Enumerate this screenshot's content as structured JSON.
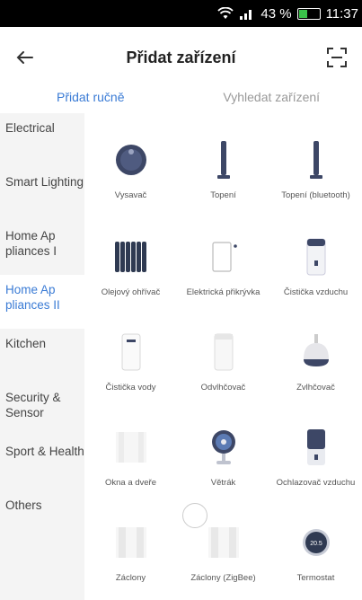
{
  "status_bar": {
    "battery": "43 %",
    "time": "11:37"
  },
  "header": {
    "title": "Přidat zařízení"
  },
  "tabs": [
    {
      "label": "Přidat ručně",
      "active": true
    },
    {
      "label": "Vyhledat zařízení",
      "active": false
    }
  ],
  "sidebar": {
    "items": [
      {
        "label": "Electrical"
      },
      {
        "label": "Smart Lighting"
      },
      {
        "label": "Home Ap pliances I"
      },
      {
        "label": "Home Ap pliances II",
        "active": true
      },
      {
        "label": "Kitchen"
      },
      {
        "label": "Security & Sensor"
      },
      {
        "label": "Sport & Health"
      },
      {
        "label": "Others"
      }
    ]
  },
  "devices": [
    {
      "label": "Vysavač",
      "icon": "robot-vacuum-icon"
    },
    {
      "label": "Topení",
      "icon": "tower-heater-icon"
    },
    {
      "label": "Topení (bluetooth)",
      "icon": "tower-heater-bluetooth-icon"
    },
    {
      "label": "Olejový ohřívač",
      "icon": "oil-heater-icon"
    },
    {
      "label": "Elektrická přikrývka",
      "icon": "electric-blanket-icon"
    },
    {
      "label": "Čistička vzduchu",
      "icon": "air-purifier-icon"
    },
    {
      "label": "Čistička vody",
      "icon": "water-purifier-icon"
    },
    {
      "label": "Odvlhčovač",
      "icon": "dehumidifier-icon"
    },
    {
      "label": "Zvlhčovač",
      "icon": "humidifier-icon"
    },
    {
      "label": "Okna a dveře",
      "icon": "window-door-icon"
    },
    {
      "label": "Větrák",
      "icon": "fan-icon"
    },
    {
      "label": "Ochlazovač vzduchu",
      "icon": "air-cooler-icon"
    },
    {
      "label": "Záclony",
      "icon": "curtains-icon"
    },
    {
      "label": "Záclony (ZigBee)",
      "icon": "curtains-zigbee-icon"
    },
    {
      "label": "Termostat",
      "icon": "thermostat-icon"
    }
  ],
  "thermostat_display": "20.5",
  "colors": {
    "accent": "#3a7bd5",
    "sidebar_bg": "#f4f4f4",
    "icon_dark": "#2f3a52"
  }
}
